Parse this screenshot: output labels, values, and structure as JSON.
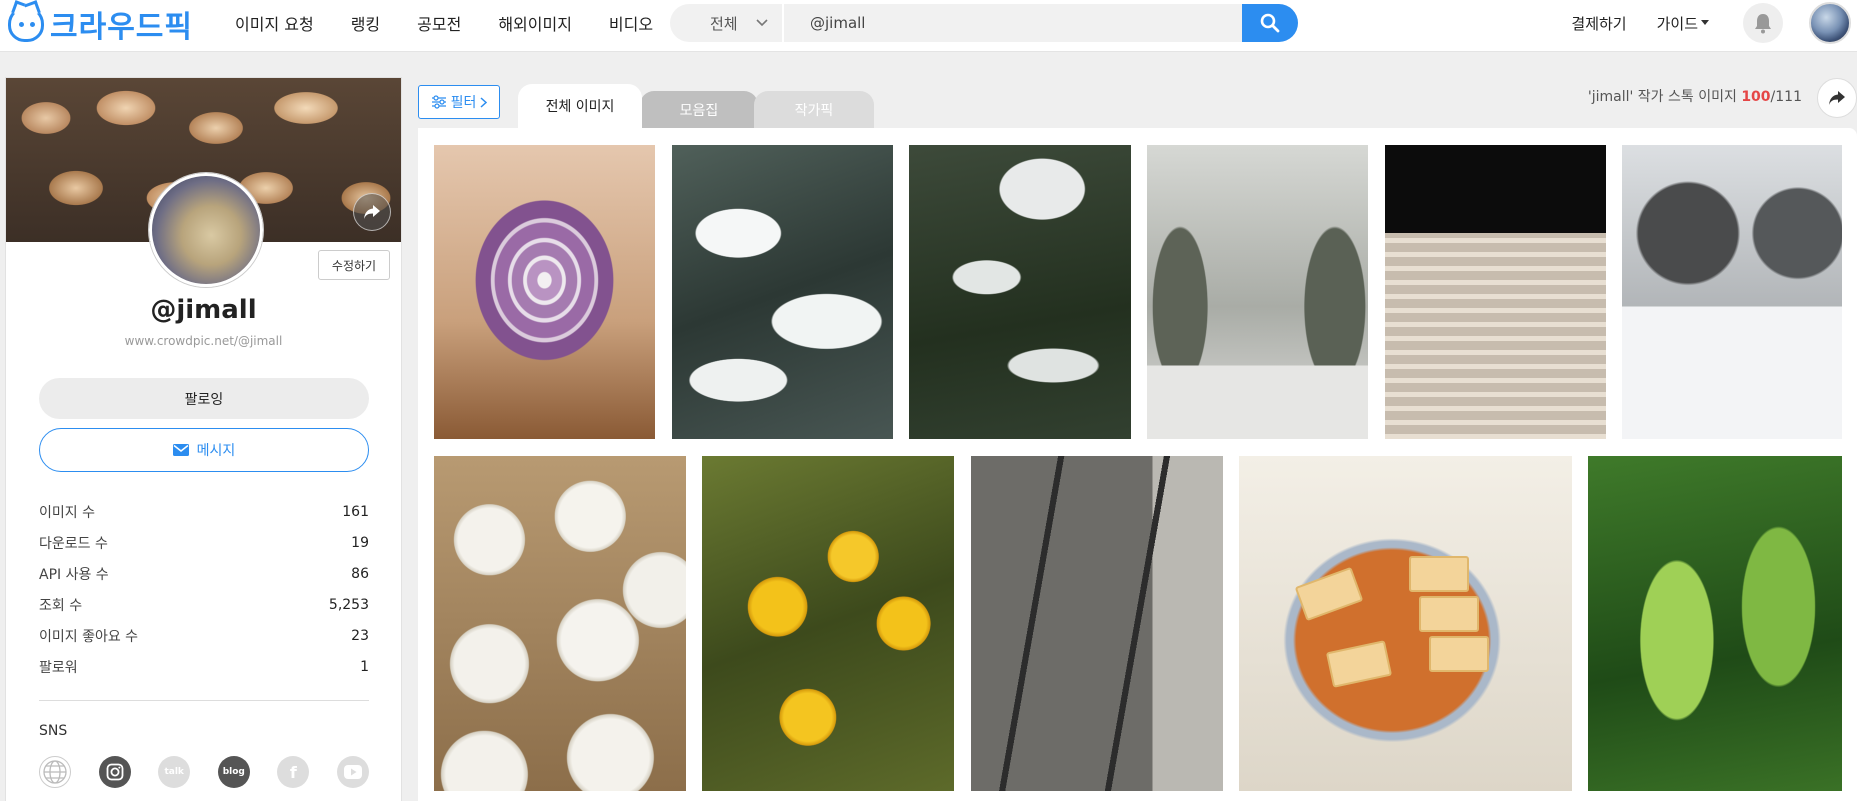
{
  "header": {
    "logo_text": "크라우드픽",
    "nav": [
      "이미지 요청",
      "랭킹",
      "공모전",
      "해외이미지",
      "비디오"
    ],
    "search": {
      "category": "전체",
      "query": "@jimall"
    },
    "right_links": {
      "payment": "결제하기",
      "guide": "가이드"
    }
  },
  "profile": {
    "edit_label": "수정하기",
    "username": "@jimall",
    "url": "www.crowdpic.net/@jimall",
    "follow_label": "팔로잉",
    "message_label": "메시지",
    "stats": [
      {
        "label": "이미지 수",
        "value": "161"
      },
      {
        "label": "다운로드 수",
        "value": "19"
      },
      {
        "label": "API 사용 수",
        "value": "86"
      },
      {
        "label": "조회 수",
        "value": "5,253"
      },
      {
        "label": "이미지 좋아요 수",
        "value": "23"
      },
      {
        "label": "팔로워",
        "value": "1"
      }
    ],
    "sns_title": "SNS",
    "sns": [
      "globe-icon",
      "instagram-icon",
      "kakaotalk-icon",
      "blog-icon",
      "facebook-icon",
      "youtube-icon"
    ],
    "sns_labels": {
      "kakao": "talk",
      "blog": "blog",
      "facebook": "f"
    }
  },
  "content": {
    "filter_label": "필터",
    "tabs": [
      "전체 이미지",
      "모음집",
      "작가픽"
    ],
    "stock": {
      "prefix": "'jimall' 작가 스톡 이미지 ",
      "count": "100",
      "total": "/111"
    },
    "photos": [
      "onion",
      "snowy-pine-1",
      "snowy-pine-2",
      "snowy-stairs",
      "night-stairs",
      "snowy-park",
      "dumplings",
      "yellow-flowers",
      "railway-track",
      "braised-tofu",
      "green-leaves"
    ]
  },
  "colors": {
    "accent": "#2c8df0",
    "highlight": "#e54646"
  }
}
